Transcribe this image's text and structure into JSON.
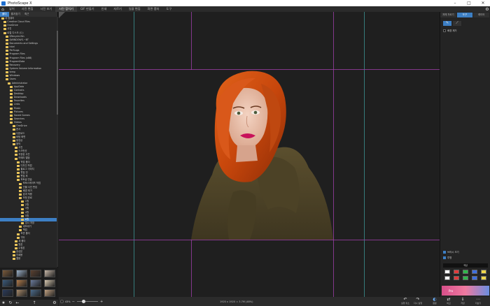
{
  "window": {
    "title": "PhotoScape X"
  },
  "menu": {
    "items": [
      "뷰어",
      "사진 편집",
      "사진 보기",
      "사진 합치기",
      "GIF 만들기",
      "인쇄",
      "자르기",
      "일괄 편집",
      "화면 캡처",
      "도구"
    ],
    "active_index": 3
  },
  "left_panel": {
    "tabs": [
      "폴더",
      "즐겨찾기",
      "최근"
    ],
    "tree": [
      "내 컴퓨터",
      "Creative Cloud Files",
      "OneDrive",
      "사진",
      "로컬 디스크 (C:)",
      "$Recycle.Bin",
      "$WINDOWS.~BT",
      "Documents and Settings",
      "Intel",
      "PerfLogs",
      "Program Files",
      "Program Files (x86)",
      "ProgramData",
      "Recovery",
      "System Volume Information",
      "temp",
      "Windows",
      "Users",
      "Administrator",
      "AppData",
      "Contacts",
      "Desktop",
      "Downloads",
      "Favorites",
      "Links",
      "Music",
      "Pictures",
      "Saved Games",
      "Searches",
      "Videos",
      "OneDrive",
      "문서",
      "다운로드",
      "바탕 화면",
      "동영상",
      "음악",
      "사진",
      "스크린샷",
      "저장된 사진",
      "카메라 앨범",
      "작업 폴더",
      "디자인 작업",
      "블로그 이미지",
      "편집 전",
      "편집 후",
      "포토샵 연습",
      "포토스케이프 작업",
      "인물 사진 편집",
      "배경 제거",
      "효과 적용",
      "보정 완료",
      "1월",
      "2월",
      "3월",
      "4월",
      "5월",
      "6월",
      "임시 저장",
      "내보내기",
      "백업",
      "보관 폴더",
      "기타",
      "새 폴더",
      "원본",
      "수정본",
      "완성본",
      "인쇄용",
      "웹용"
    ],
    "selected_index": 56
  },
  "canvas": {
    "photo_description_name": "portrait-photo"
  },
  "bottom_bar": {
    "zoom_label": "43%",
    "status": "1920 x 1920 = 3.7M (48%)",
    "tools": [
      "실행 취소",
      "다시 실행",
      "원본",
      "비교",
      "저장",
      "더보기"
    ]
  },
  "right_panel": {
    "tabs": [
      "개체 자르기",
      "도구",
      "레이어"
    ],
    "tool_labels": [
      "✎",
      "⟋"
    ],
    "checkbox_top": "배경 제거",
    "checkbox_1": "브러시 크기",
    "checkbox_2": "투명",
    "palette_title": "색상",
    "ad_text": "Pro"
  },
  "colors": {
    "accent": "#3d7fc4",
    "guide_cyan": "#3fa2a2",
    "guide_purple": "#9b3fa6",
    "palette": [
      "#ffffff",
      "#e23a3a",
      "#2fb84a",
      "#3d6fe0",
      "#f0d64a",
      "#ffffff",
      "#e23a3a",
      "#2fb84a",
      "#3d6fe0",
      "#f0d64a"
    ]
  }
}
